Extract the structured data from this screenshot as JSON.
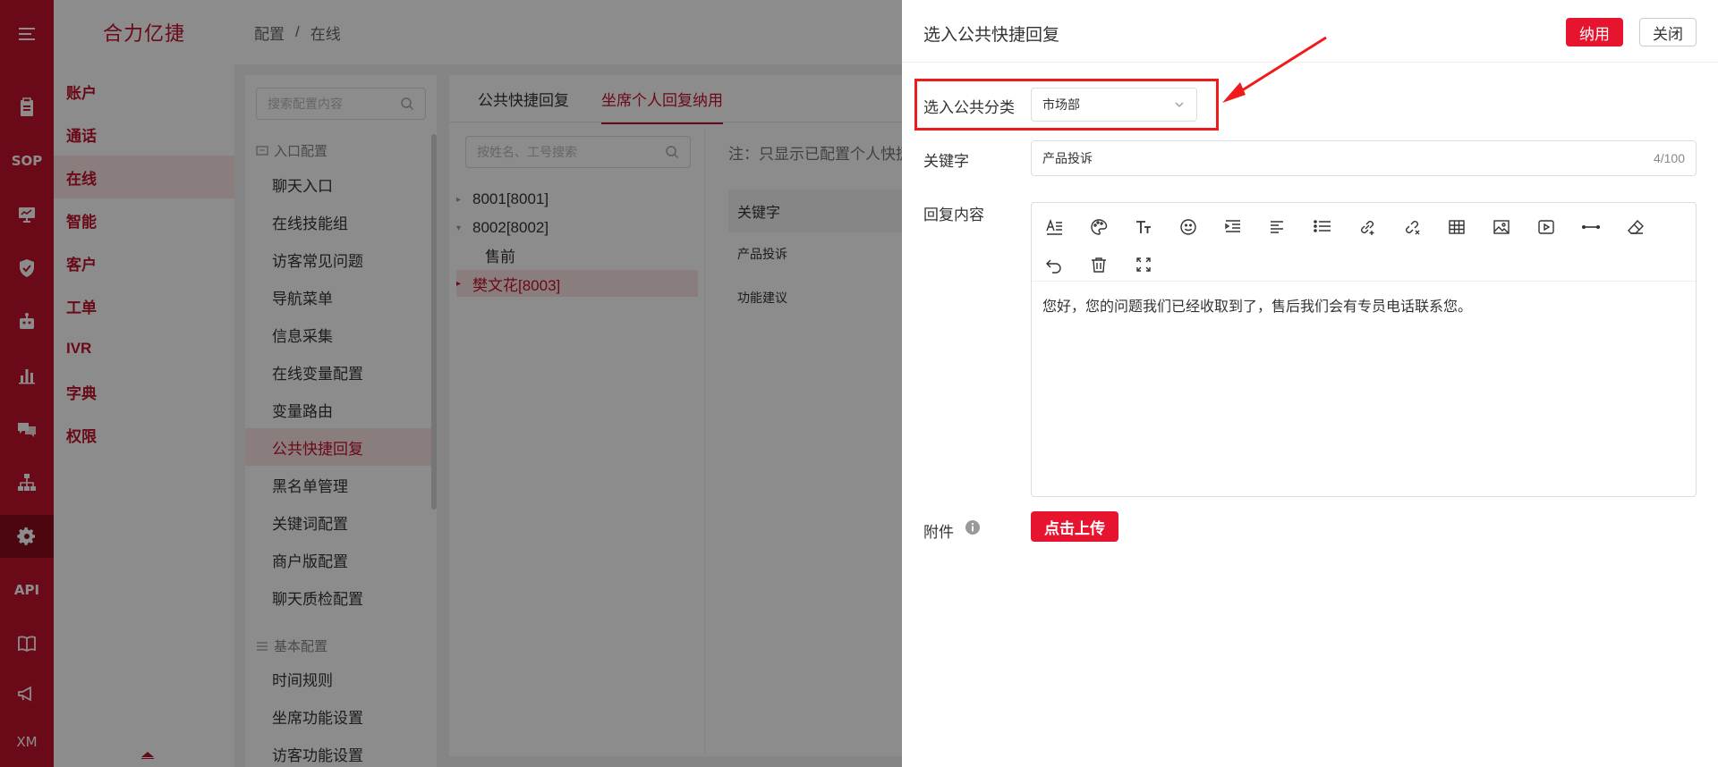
{
  "brand": "合力亿捷",
  "breadcrumb": [
    "配置",
    "在线"
  ],
  "rail": {
    "items": [
      "menu-icon",
      "clipboard-icon",
      "SOP",
      "monitor-icon",
      "shield-icon",
      "robot-icon",
      "chart-icon",
      "chat-icon",
      "org-icon",
      "gear-icon",
      "API",
      "book-icon",
      "megaphone-icon",
      "XM"
    ]
  },
  "modules": [
    "账户",
    "通话",
    "在线",
    "智能",
    "客户",
    "工单",
    "IVR",
    "字典",
    "权限"
  ],
  "active_module": "在线",
  "config_nav": {
    "search_placeholder": "搜索配置内容",
    "section1": "入口配置",
    "items1": [
      "聊天入口",
      "在线技能组",
      "访客常见问题",
      "导航菜单",
      "信息采集",
      "在线变量配置",
      "变量路由",
      "公共快捷回复",
      "黑名单管理",
      "关键词配置",
      "商户版配置",
      "聊天质检配置"
    ],
    "section2": "基本配置",
    "items2": [
      "时间规则",
      "坐席功能设置",
      "访客功能设置"
    ],
    "active": "公共快捷回复"
  },
  "content": {
    "tabs": [
      "公共快捷回复",
      "坐席个人回复纳用"
    ],
    "active_tab": "坐席个人回复纳用",
    "search_placeholder": "按姓名、工号搜索",
    "tree": [
      {
        "label": "8001[8001]",
        "caret": "▸"
      },
      {
        "label": "8002[8002]",
        "caret": "▾"
      },
      {
        "label": "售前",
        "caret": ""
      },
      {
        "label": "樊文花[8003]",
        "caret": "▸"
      }
    ],
    "note": "注：只显示已配置个人快捷",
    "column_header": "关键字",
    "rows": [
      "产品投诉",
      "功能建议"
    ]
  },
  "drawer": {
    "title": "选入公共快捷回复",
    "adopt_button": "纳用",
    "close_button": "关闭",
    "category_label": "选入公共分类",
    "category_value": "市场部",
    "keyword_label": "关键字",
    "keyword_value": "产品投诉",
    "keyword_count": "4/100",
    "reply_label": "回复内容",
    "reply_text": "您好，您的问题我们已经收取到了，售后我们会有专员电话联系您。",
    "attachment_label": "附件",
    "upload_button": "点击上传"
  },
  "colors": {
    "brand": "#c2112b",
    "primary_button": "#e6142f",
    "highlight_box": "#f01a1a"
  }
}
